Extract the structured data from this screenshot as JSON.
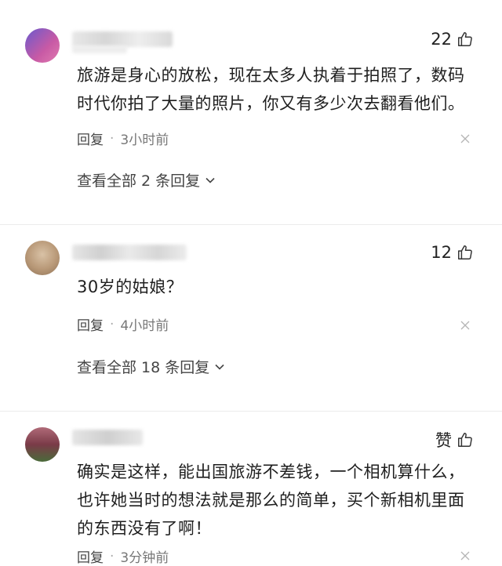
{
  "comments": [
    {
      "likes": "22",
      "text_lines": [
        "旅游是身心的放松，现在太多人执着于拍照了，数码",
        "时代你拍了大量的照片，你又有多少次去翻看他们。"
      ],
      "reply_label": "回复",
      "separator": "·",
      "time": "3小时前",
      "view_replies": "查看全部 2 条回复"
    },
    {
      "likes": "12",
      "text_lines": [
        "30岁的姑娘？"
      ],
      "reply_label": "回复",
      "separator": "·",
      "time": "4小时前",
      "view_replies": "查看全部 18 条回复"
    },
    {
      "likes": "赞",
      "text_lines": [
        "确实是这样，能出国旅游不差钱，一个相机算什么，",
        "也许她当时的想法就是那么的简单，买个新相机里面",
        "的东西没有了啊！"
      ],
      "reply_label": "回复",
      "separator": "·",
      "time": "3分钟前"
    }
  ],
  "icons": {
    "like": "thumbs-up-icon",
    "close": "close-icon",
    "chevron": "chevron-down-icon"
  },
  "colors": {
    "text": "#1f1f1f",
    "meta": "#777777"
  }
}
